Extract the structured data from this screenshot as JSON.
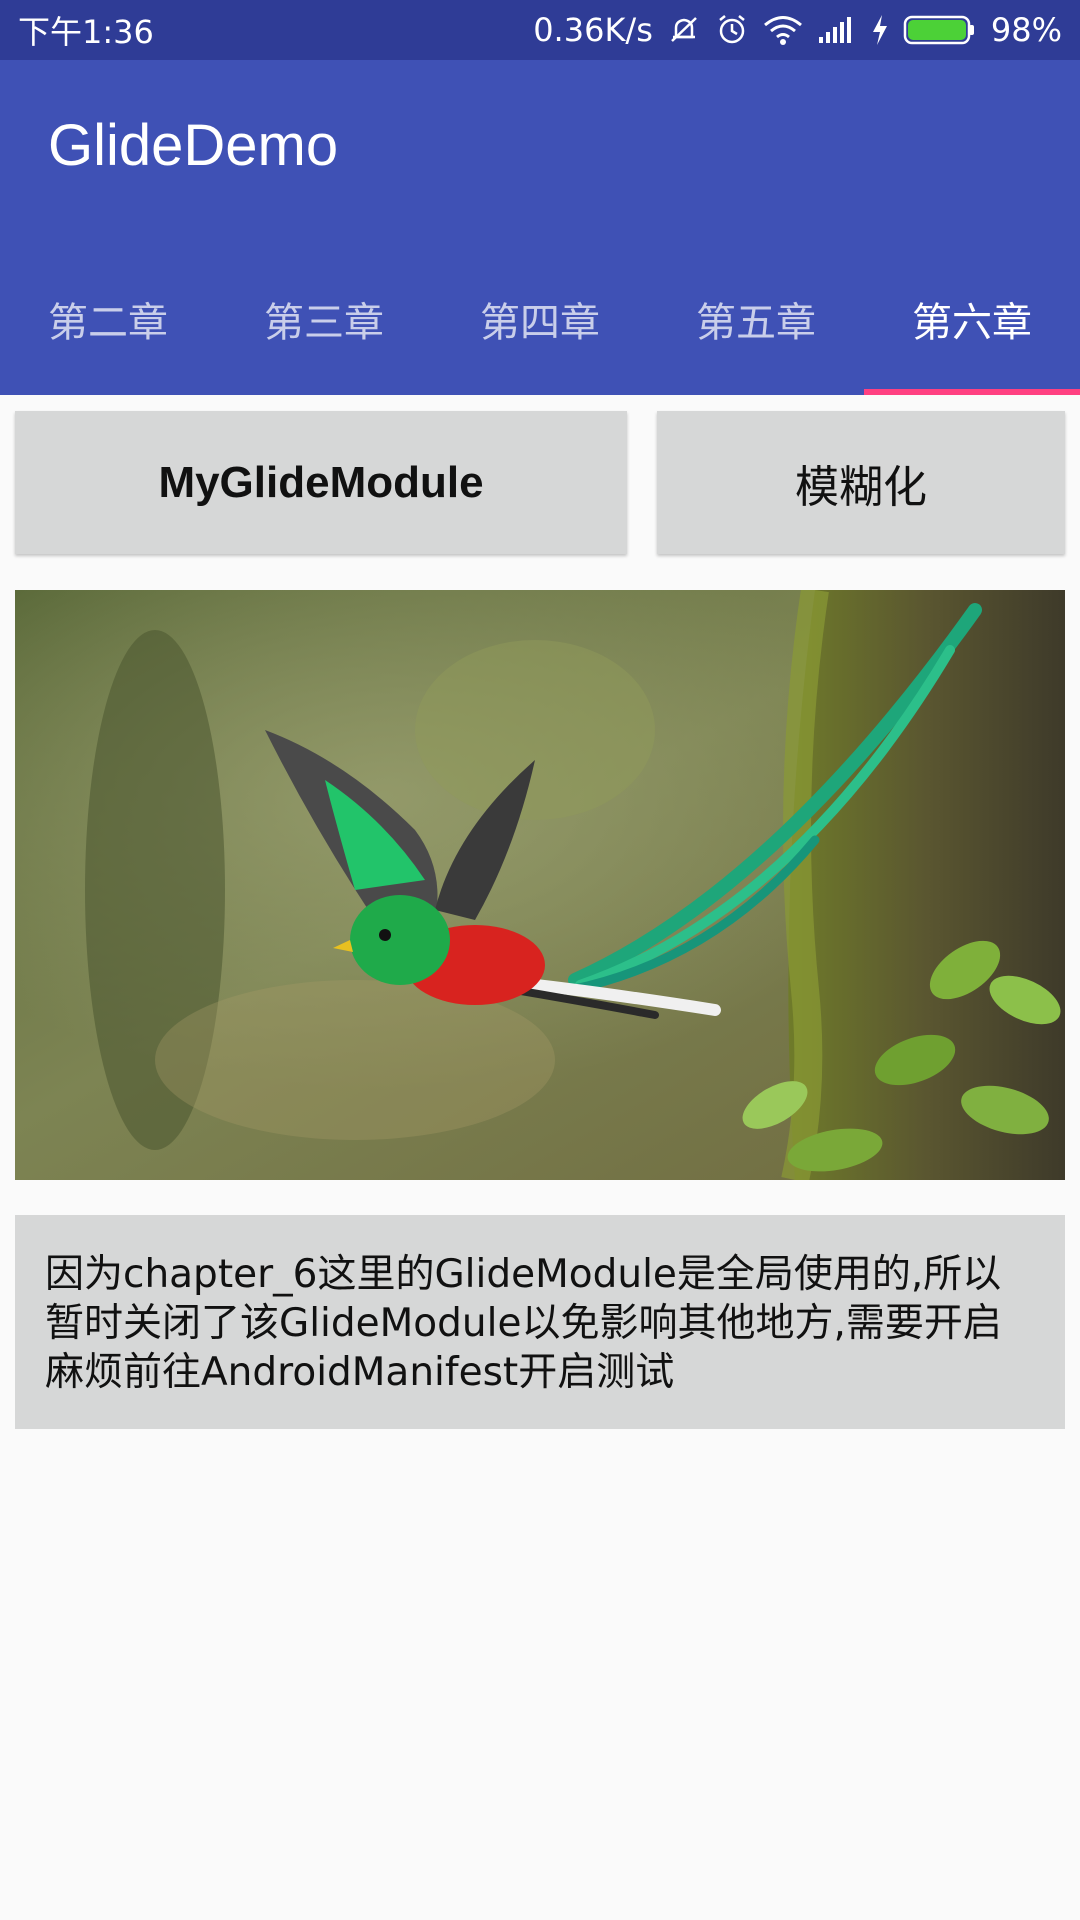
{
  "status_bar": {
    "time": "下午1:36",
    "speed": "0.36K/s",
    "battery": "98%",
    "icons": [
      "mute-icon",
      "alarm-icon",
      "wifi-icon",
      "signal-icon",
      "charging-icon",
      "battery-icon"
    ],
    "battery_color": "#4cd137"
  },
  "app_bar": {
    "title": "GlideDemo",
    "color": "#3f51b5"
  },
  "tabs": [
    {
      "label": "第二章"
    },
    {
      "label": "第三章"
    },
    {
      "label": "第四章"
    },
    {
      "label": "第五章"
    },
    {
      "label": "第六章",
      "active": true
    }
  ],
  "accent_color": "#ff4081",
  "buttons": {
    "module": "MyGlideModule",
    "blur": "模糊化"
  },
  "note": "因为chapter_6这里的GlideModule是全局使用的,所以暂时关闭了该GlideModule以免影响其他地方,需要开启麻烦前往AndroidManifest开启测试"
}
